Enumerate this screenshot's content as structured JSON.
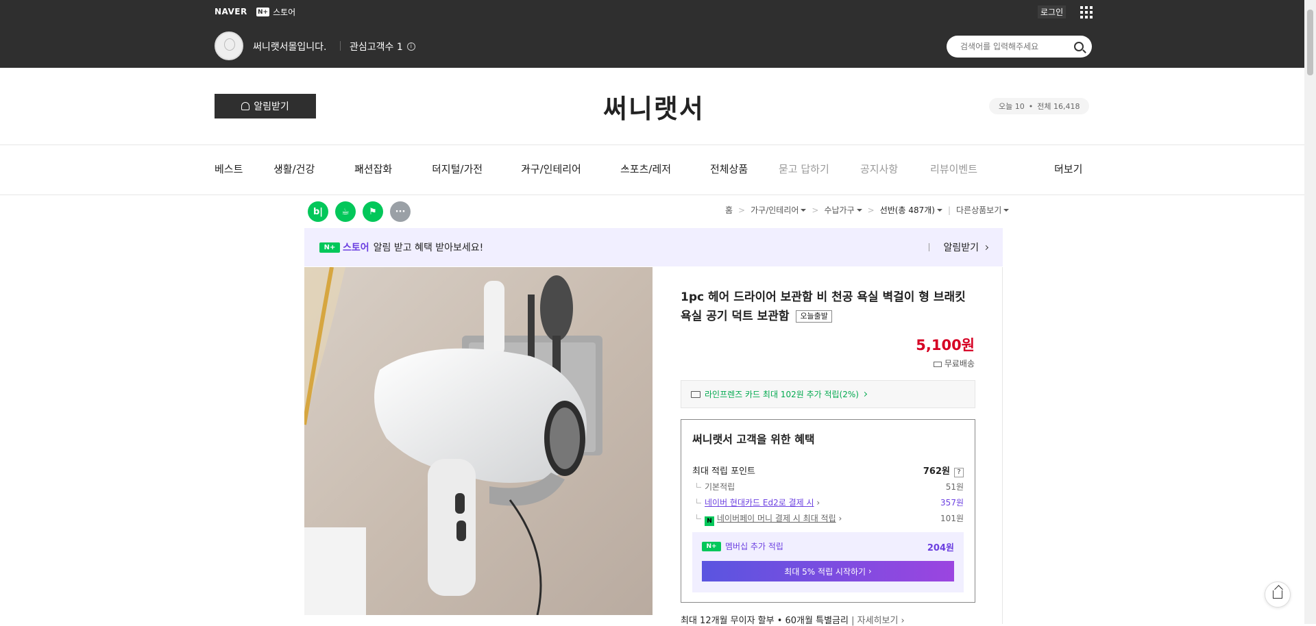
{
  "topbar": {
    "naver": "NAVER",
    "nplus_badge": "N+",
    "store_label": "스토어",
    "login": "로그인"
  },
  "profile": {
    "shop_name": "써니랫서몰입니다.",
    "fans_label": "관심고객수 1"
  },
  "search": {
    "placeholder": "검색어를 입력해주세요"
  },
  "header": {
    "alarm_button": "알림받기",
    "store_title": "써니랫서",
    "visitors_today": "오늘 10",
    "visitors_total": "전체 16,418"
  },
  "nav": {
    "items": [
      "베스트",
      "생활/건강",
      "패션잡화",
      "디지털/가전",
      "가구/인테리어",
      "스포츠/레저",
      "전체상품",
      "묻고 답하기",
      "공지사항",
      "리뷰이벤트"
    ],
    "more": "더보기"
  },
  "sns": {
    "blog": "b|",
    "cafe": "☕",
    "bookmark": "⚑",
    "more": "···",
    "colors": {
      "green": "#03c75a",
      "gray": "#9aa0a6"
    }
  },
  "breadcrumb": {
    "home": "홈",
    "level1": "가구/인테리어",
    "level2": "수납가구",
    "level3": "선반(총 487개)",
    "other": "다른상품보기"
  },
  "banner": {
    "badge": "N+",
    "store": "스토어",
    "text": "알림 받고 혜택 받아보세요!",
    "action": "알림받기"
  },
  "product": {
    "title": "1pc 헤어 드라이어 보관함 비 천공 욕실 벽걸이 형 브래킷 욕실 공기 덕트 보관함",
    "tag": "오늘출발",
    "price": "5,100원",
    "shipping": "무료배송",
    "card_promo": "라인프렌즈 카드 최대 102원 추가 적립(2%)"
  },
  "benefit": {
    "title": "써니랫서 고객을 위한 혜택",
    "max_points_label": "최대 적립 포인트",
    "max_points_value": "762원",
    "question": "?",
    "basic_label": "기본적립",
    "basic_value": "51원",
    "card_label": "네이버 현대카드 Ed2로 결제 시",
    "card_value": "357원",
    "npay_icon": "N",
    "npay_label": "네이버페이 머니 결제 시 최대 적립",
    "npay_value": "101원",
    "member_badge": "N+",
    "member_label": "멤버십 추가 적립",
    "member_value": "204원",
    "member_button": "최대 5% 적립 시작하기"
  },
  "installment": {
    "text": "최대 12개월 무이자 할부 • 60개월 특별금리",
    "detail": "자세히보기"
  },
  "colors": {
    "dark_header": "#2f2f2f",
    "price_red": "#d60023",
    "purple": "#6b3fe0",
    "green": "#03c75a"
  }
}
